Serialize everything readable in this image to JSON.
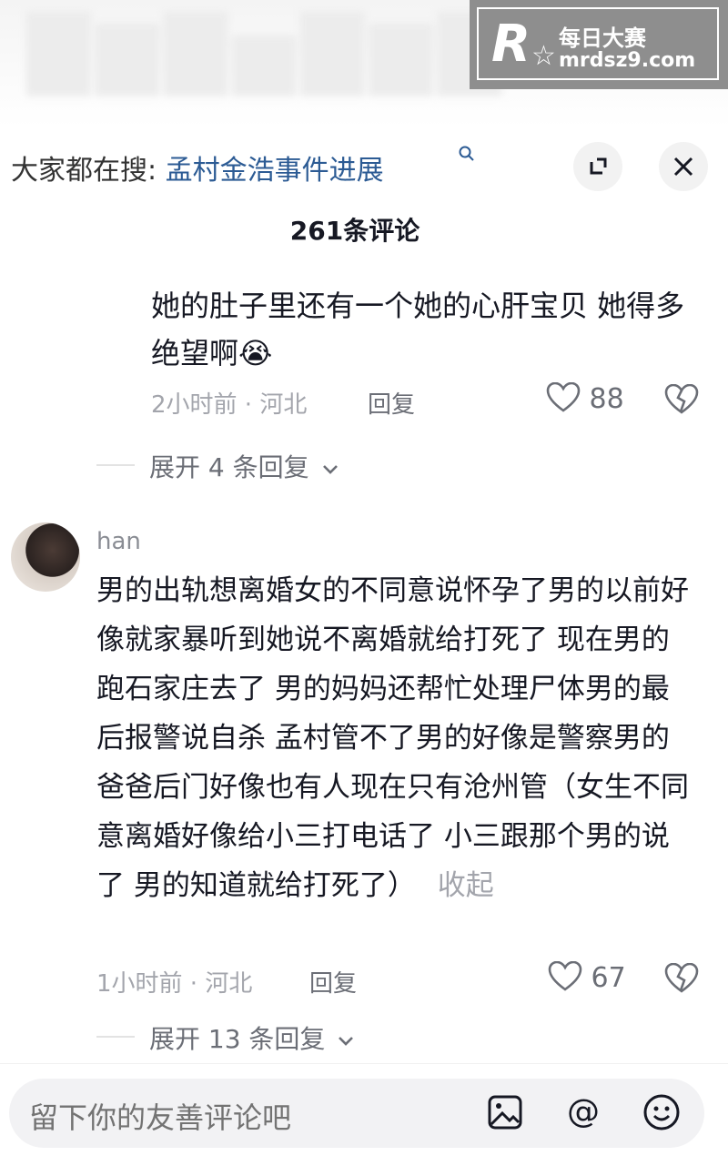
{
  "watermark": {
    "logo_letter": "R",
    "title": "每日大赛",
    "url": "mrdsz9.com"
  },
  "search": {
    "prefix": "大家都在搜:",
    "query": "孟村金浩事件进展"
  },
  "header": {
    "comment_count_title": "261条评论"
  },
  "comments": [
    {
      "text": "她的肚子里还有一个她的心肝宝贝 她得多绝望啊😭",
      "time_location": "2小时前 · 河北",
      "reply_label": "回复",
      "likes": "88",
      "expand_label": "展开 4 条回复"
    },
    {
      "username": "han",
      "text": "男的出轨想离婚女的不同意说怀孕了男的以前好像就家暴听到她说不离婚就给打死了 现在男的跑石家庄去了 男的妈妈还帮忙处理尸体男的最后报警说自杀 孟村管不了男的好像是警察男的爸爸后门好像也有人现在只有沧州管（女生不同意离婚好像给小三打电话了 小三跟那个男的说了 男的知道就给打死了）",
      "collapse_label": "收起",
      "time_location": "1小时前 · 河北",
      "reply_label": "回复",
      "likes": "67",
      "expand_label": "展开 13 条回复"
    }
  ],
  "input": {
    "placeholder": "留下你的友善评论吧"
  },
  "icons": {
    "search": "search-icon",
    "expand": "expand-icon",
    "close": "close-icon",
    "like": "heart-icon",
    "dislike": "broken-heart-icon",
    "chevron": "chevron-down-icon",
    "image": "image-icon",
    "mention": "at-icon",
    "emoji": "emoji-icon"
  }
}
